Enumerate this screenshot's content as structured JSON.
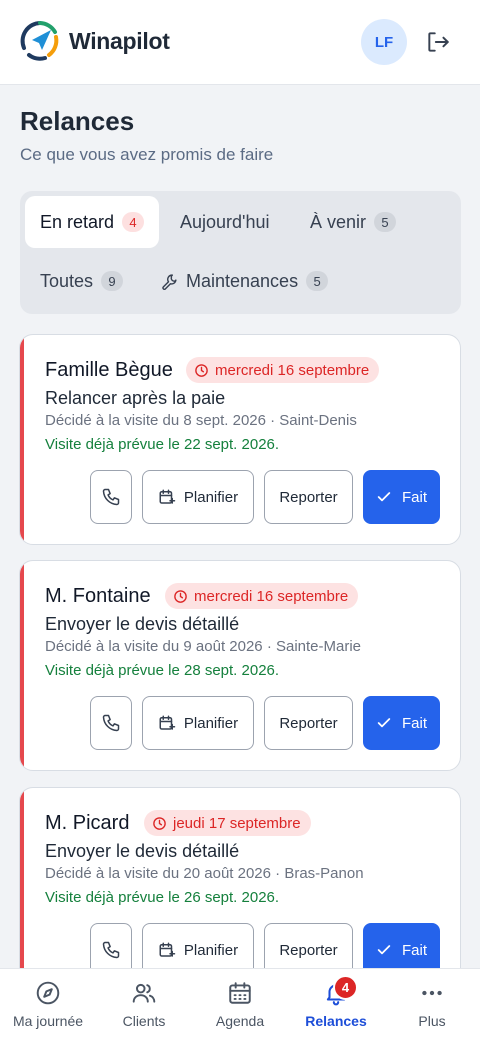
{
  "app": {
    "brand": "Winapilot",
    "user_initials": "LF"
  },
  "header": {
    "title": "Relances",
    "subtitle": "Ce que vous avez promis de faire"
  },
  "tabs": [
    {
      "label": "En retard",
      "count": "4",
      "active": true
    },
    {
      "label": "Aujourd'hui",
      "count": ""
    },
    {
      "label": "À venir",
      "count": "5"
    },
    {
      "label": "Toutes",
      "count": "9"
    },
    {
      "label": "Maintenances",
      "count": "5",
      "icon": "wrench-icon"
    }
  ],
  "cards": [
    {
      "name": "Famille Bègue",
      "date": "mercredi 16 septembre",
      "title": "Relancer après la paie",
      "meta": "Décidé à la visite du 8 sept. 2026 · Saint-Denis",
      "planned": "Visite déjà prévue le 22 sept. 2026."
    },
    {
      "name": "M. Fontaine",
      "date": "mercredi 16 septembre",
      "title": "Envoyer le devis détaillé",
      "meta": "Décidé à la visite du 9 août 2026 · Sainte-Marie",
      "planned": "Visite déjà prévue le 28 sept. 2026."
    },
    {
      "name": "M. Picard",
      "date": "jeudi 17 septembre",
      "title": "Envoyer le devis détaillé",
      "meta": "Décidé à la visite du 20 août 2026 · Bras-Panon",
      "planned": "Visite déjà prévue le 26 sept. 2026."
    }
  ],
  "actions": {
    "plan": "Planifier",
    "report": "Reporter",
    "done": "Fait"
  },
  "nav": [
    {
      "label": "Ma journée",
      "icon": "compass-icon"
    },
    {
      "label": "Clients",
      "icon": "users-icon"
    },
    {
      "label": "Agenda",
      "icon": "calendar-icon"
    },
    {
      "label": "Relances",
      "icon": "bell-icon",
      "active": true,
      "badge": "4"
    },
    {
      "label": "Plus",
      "icon": "more-icon"
    }
  ],
  "colors": {
    "accent": "#2563eb",
    "overdue": "#e5484d",
    "success": "#15803d"
  }
}
